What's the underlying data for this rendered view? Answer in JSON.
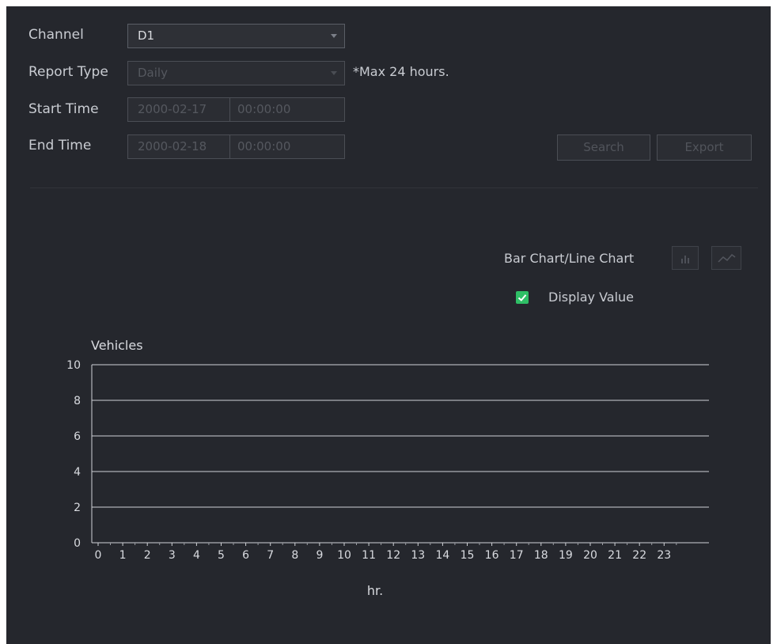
{
  "form": {
    "channel": {
      "label": "Channel",
      "value": "D1"
    },
    "report_type": {
      "label": "Report Type",
      "value": "Daily",
      "note": "*Max 24 hours."
    },
    "start_time": {
      "label": "Start Time",
      "date": "2000-02-17",
      "time": "00:00:00"
    },
    "end_time": {
      "label": "End Time",
      "date": "2000-02-18",
      "time": "00:00:00"
    },
    "search_label": "Search",
    "export_label": "Export"
  },
  "chart_controls": {
    "toggle_label": "Bar Chart/Line Chart",
    "display_value_label": "Display Value",
    "display_value_checked": true,
    "accent": "#2fbf66"
  },
  "chart_data": {
    "type": "line",
    "ylabel": "Vehicles",
    "xlabel": "hr.",
    "ylim": [
      0,
      10
    ],
    "y_ticks": [
      0,
      2,
      4,
      6,
      8,
      10
    ],
    "x": [
      0,
      1,
      2,
      3,
      4,
      5,
      6,
      7,
      8,
      9,
      10,
      11,
      12,
      13,
      14,
      15,
      16,
      17,
      18,
      19,
      20,
      21,
      22,
      23
    ],
    "series": [],
    "grid": true
  }
}
